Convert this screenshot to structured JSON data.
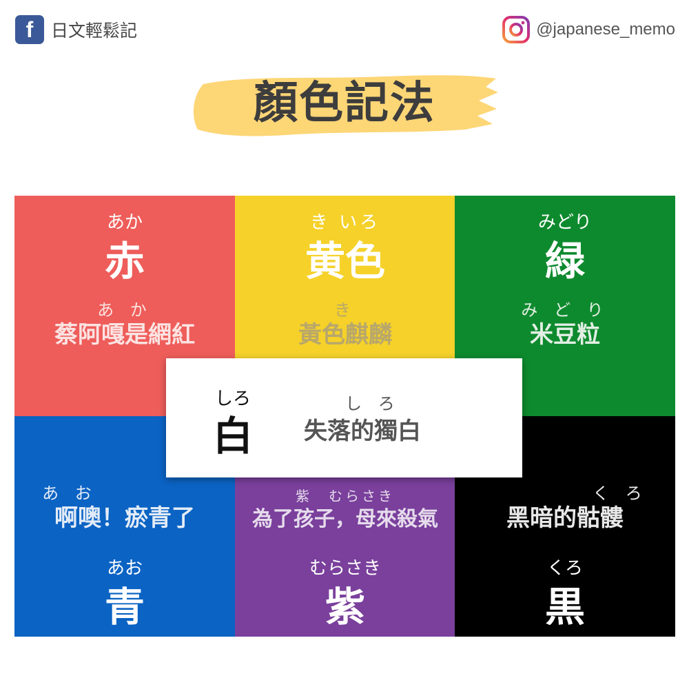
{
  "header": {
    "facebook_icon": "facebook-icon",
    "facebook_page": "日文輕鬆記",
    "instagram_icon": "instagram-icon",
    "instagram_handle": "@japanese_memo"
  },
  "title": "顏色記法",
  "colors": {
    "red": "#ee5d5a",
    "yellow": "#f5d12a",
    "green": "#0e8a2e",
    "blue": "#0b63c4",
    "purple": "#7a409c",
    "black": "#000000",
    "brush": "#fdd676"
  },
  "cells": {
    "aka": {
      "reading": "あか",
      "kanji": "赤",
      "mnemonic_reading": "あ か",
      "mnemonic": "蔡阿嘎是網紅"
    },
    "kiiro": {
      "reading": "き いろ",
      "kanji": "黄色",
      "mnemonic_reading": "き",
      "mnemonic": "黃色麒麟"
    },
    "midori": {
      "reading": "みどり",
      "kanji": "緑",
      "mnemonic_reading": "み ど り",
      "mnemonic": "米豆粒"
    },
    "shiro": {
      "reading": "しろ",
      "kanji": "白",
      "mnemonic_reading": "し ろ",
      "mnemonic": "失落的獨白"
    },
    "ao": {
      "reading": "あお",
      "kanji": "青",
      "mnemonic_reading": "あ お",
      "mnemonic": "啊噢！瘀青了"
    },
    "murasaki": {
      "reading": "むらさき",
      "kanji": "紫",
      "mnemonic_reading": "紫　むらさき",
      "mnemonic": "為了孩子，母來殺氣"
    },
    "kuro": {
      "reading": "くろ",
      "kanji": "黒",
      "mnemonic_reading": "く ろ",
      "mnemonic": "黑暗的骷髏"
    }
  }
}
